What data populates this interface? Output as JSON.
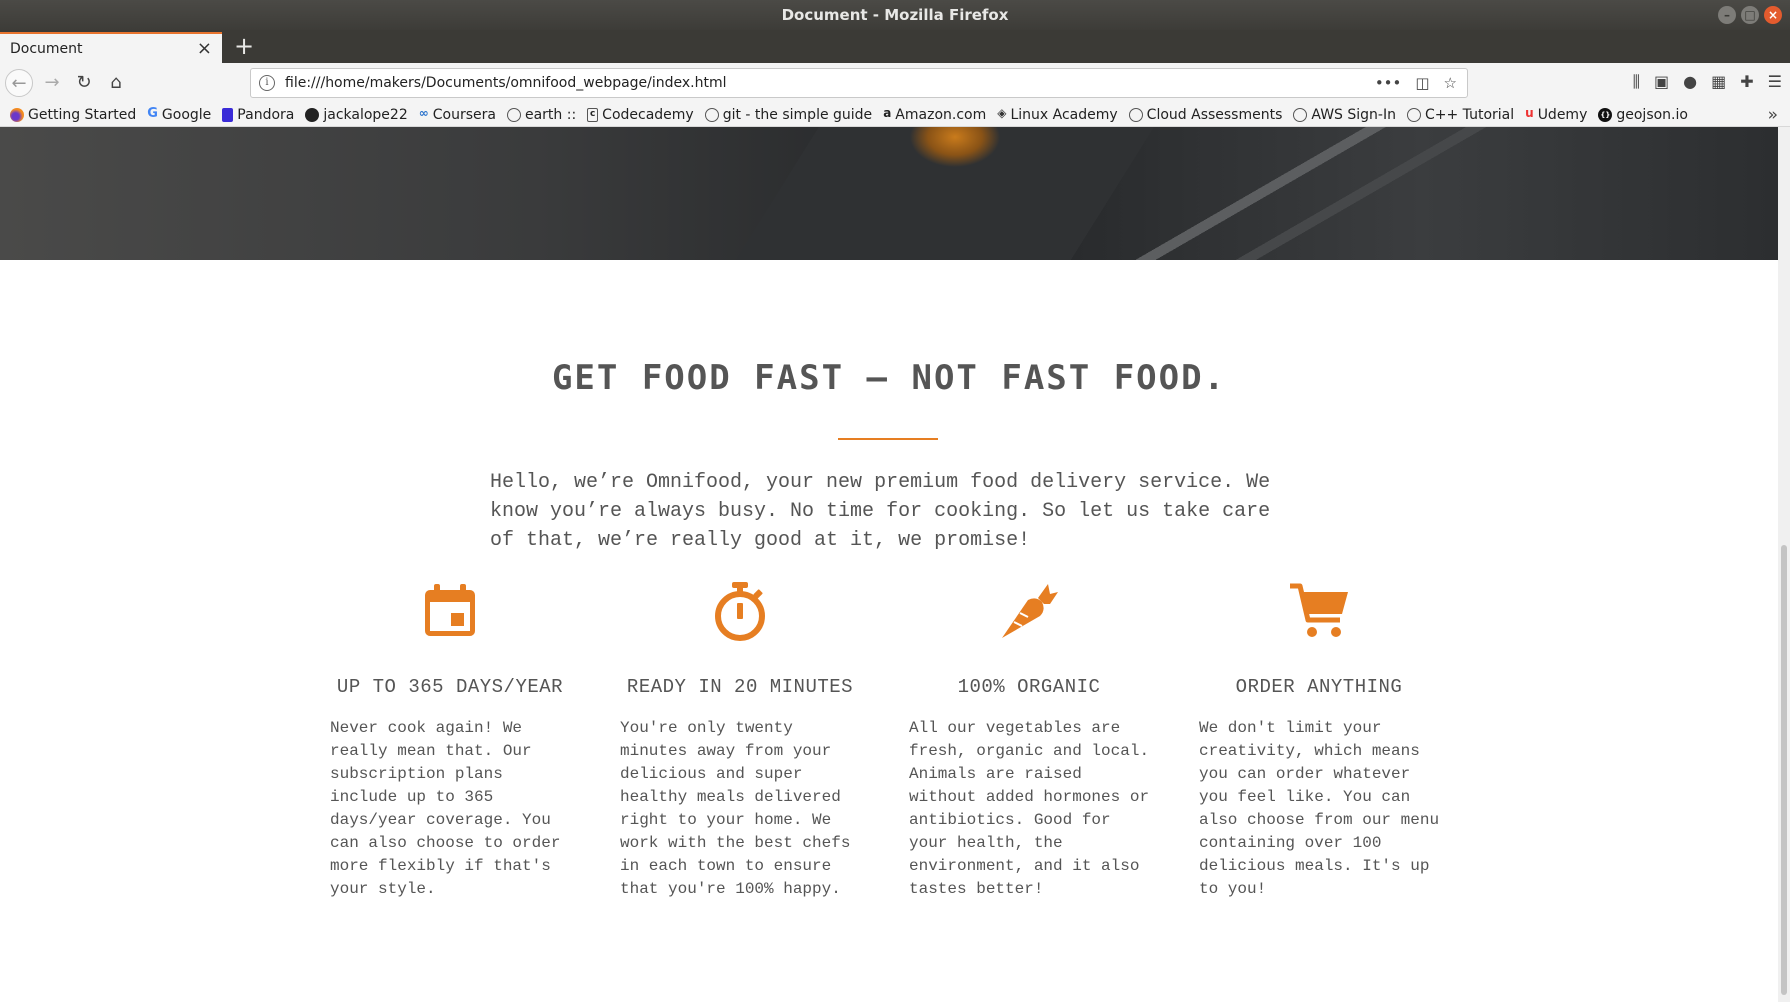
{
  "window": {
    "title": "Document - Mozilla Firefox"
  },
  "tabs": [
    {
      "title": "Document"
    }
  ],
  "navbar": {
    "url": "file:///home/makers/Documents/omnifood_webpage/index.html"
  },
  "bookmarks": [
    {
      "label": "Getting Started",
      "icon": "firefox-icon"
    },
    {
      "label": "Google",
      "icon": "google-icon"
    },
    {
      "label": "Pandora",
      "icon": "pandora-icon"
    },
    {
      "label": "jackalope22",
      "icon": "github-icon"
    },
    {
      "label": "Coursera",
      "icon": "coursera-icon"
    },
    {
      "label": "earth ::",
      "icon": "globe-icon"
    },
    {
      "label": "Codecademy",
      "icon": "codecademy-icon"
    },
    {
      "label": "git - the simple guide",
      "icon": "globe-icon"
    },
    {
      "label": "Amazon.com",
      "icon": "amazon-icon"
    },
    {
      "label": "Linux Academy",
      "icon": "linux-academy-icon"
    },
    {
      "label": "Cloud Assessments",
      "icon": "globe-icon"
    },
    {
      "label": "AWS Sign-In",
      "icon": "globe-icon"
    },
    {
      "label": "C++ Tutorial",
      "icon": "globe-icon"
    },
    {
      "label": "Udemy",
      "icon": "udemy-icon"
    },
    {
      "label": "geojson.io",
      "icon": "geojson-icon"
    }
  ],
  "page": {
    "accent_color": "#e67e22",
    "headline": "GET FOOD FAST — NOT FAST FOOD.",
    "intro": "Hello, we’re Omnifood, your new premium food delivery service.  We know you’re always busy. No time for cooking. So let us take care of that, we’re really good at it, we promise!",
    "features": [
      {
        "icon": "calendar-icon",
        "title": "UP TO 365 DAYS/YEAR",
        "text": "Never cook again! We really mean that. Our subscription plans include up to 365 days/year coverage. You can also choose to order more flexibly if that's your style."
      },
      {
        "icon": "stopwatch-icon",
        "title": "READY IN 20 MINUTES",
        "text": "You're only twenty minutes away from your delicious and super healthy meals delivered right to your home. We work with the best chefs in each town to ensure that you're 100% happy."
      },
      {
        "icon": "carrot-icon",
        "title": "100% ORGANIC",
        "text": "All our vegetables are fresh, organic and local. Animals are raised without added hormones or antibiotics. Good for your health, the environment, and it also tastes better!"
      },
      {
        "icon": "cart-icon",
        "title": "ORDER ANYTHING",
        "text": "We don't limit your creativity, which means you can order whatever you feel like. You can also choose from our menu containing over 100 delicious meals. It's up to you!"
      }
    ]
  }
}
